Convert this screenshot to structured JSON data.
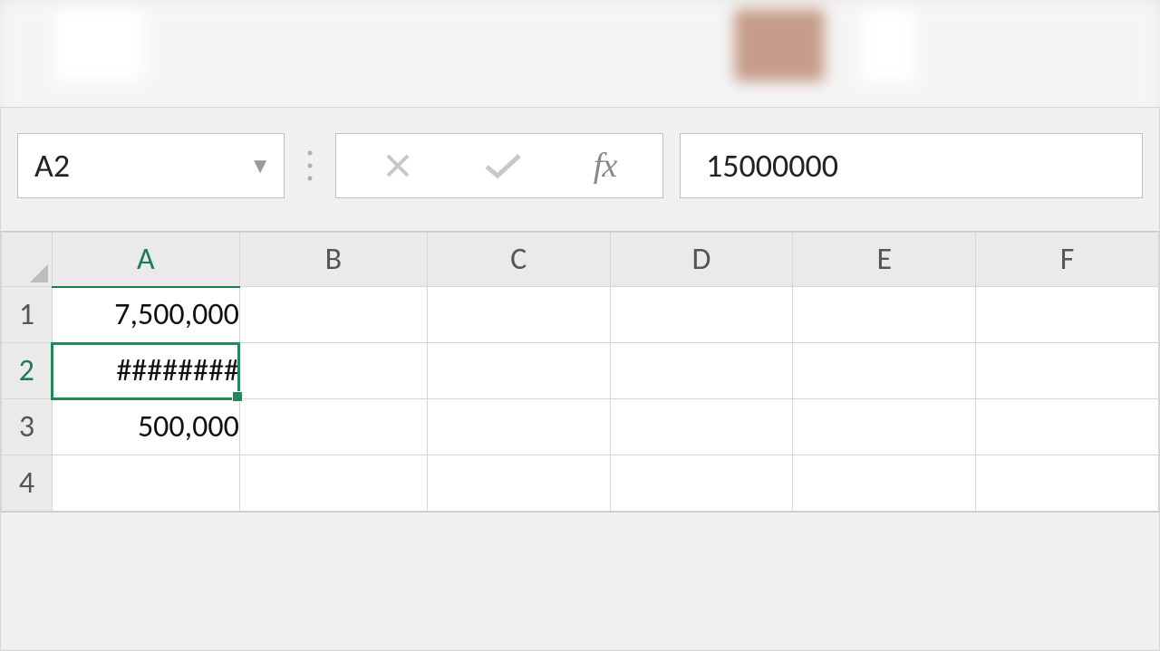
{
  "name_box": {
    "value": "A2"
  },
  "formula_bar": {
    "value": "15000000"
  },
  "icons": {
    "dropdown": "▼",
    "separator": "⁝",
    "cancel_title": "Cancel",
    "enter_title": "Enter",
    "fx_label": "fx"
  },
  "grid": {
    "columns": [
      "A",
      "B",
      "C",
      "D",
      "E",
      "F"
    ],
    "rows": [
      "1",
      "2",
      "3",
      "4"
    ],
    "selected_col_index": 0,
    "selected_row_index": 1,
    "cells": {
      "A1": "7,500,000",
      "A2": "########",
      "A3": "500,000",
      "A4": "",
      "B1": "",
      "B2": "",
      "B3": "",
      "B4": "",
      "C1": "",
      "C2": "",
      "C3": "",
      "C4": "",
      "D1": "",
      "D2": "",
      "D3": "",
      "D4": "",
      "E1": "",
      "E2": "",
      "E3": "",
      "E4": "",
      "F1": "",
      "F2": "",
      "F3": "",
      "F4": ""
    }
  }
}
